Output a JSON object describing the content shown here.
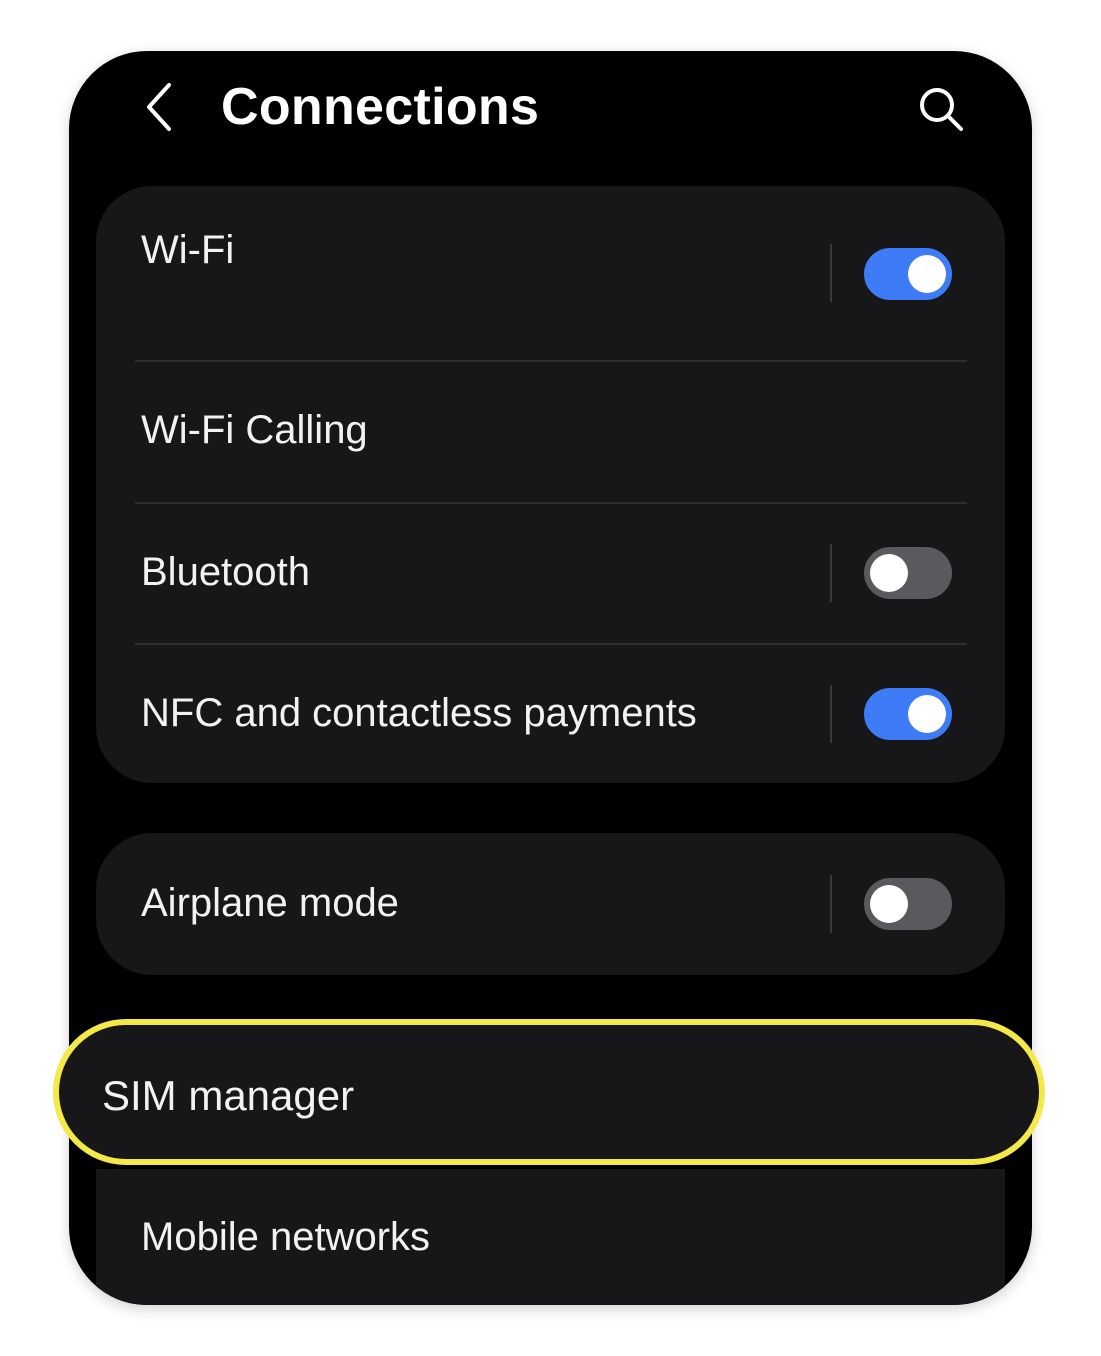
{
  "header": {
    "title": "Connections",
    "back_icon": "chevron-left-icon",
    "search_icon": "search-icon"
  },
  "colors": {
    "toggle_on": "#3e7bf7",
    "toggle_off": "#5a5a5e",
    "highlight": "#f3ea4a",
    "card_bg": "#171719"
  },
  "group1": {
    "items": [
      {
        "label": "Wi-Fi",
        "toggle": true
      },
      {
        "label": "Wi-Fi Calling"
      },
      {
        "label": "Bluetooth",
        "toggle": false
      },
      {
        "label": "NFC and contactless payments",
        "toggle": true
      }
    ]
  },
  "group2": {
    "items": [
      {
        "label": "Airplane mode",
        "toggle": false
      }
    ]
  },
  "highlighted": {
    "label": "SIM manager"
  },
  "group3": {
    "items": [
      {
        "label": "Mobile networks"
      }
    ]
  }
}
